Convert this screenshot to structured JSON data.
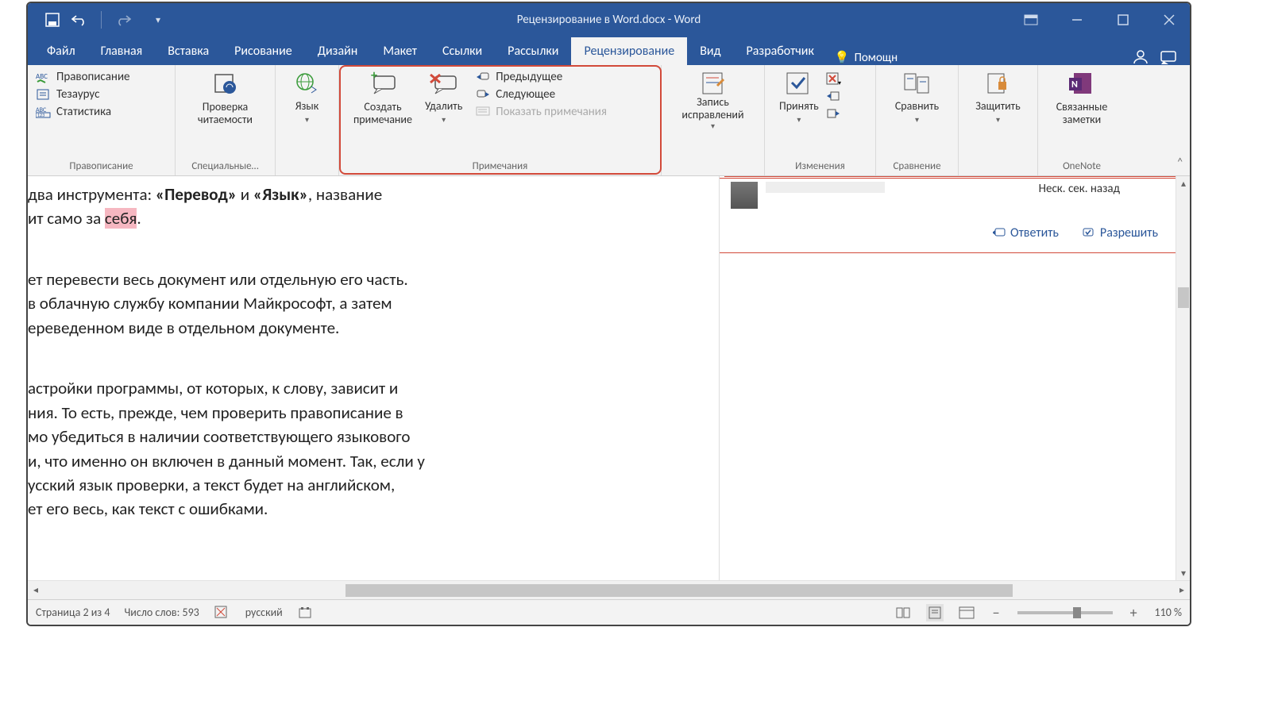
{
  "title": "Рецензирование в Word.docx  -  Word",
  "tabs": [
    "Файл",
    "Главная",
    "Вставка",
    "Рисование",
    "Дизайн",
    "Макет",
    "Ссылки",
    "Рассылки",
    "Рецензирование",
    "Вид",
    "Разработчик"
  ],
  "active_tab_index": 8,
  "tell_me": "Помощн",
  "ribbon": {
    "g1": {
      "label": "Правописание",
      "items": [
        "Правописание",
        "Тезаурус",
        "Статистика"
      ]
    },
    "g2": {
      "label": "Специальные…",
      "btn": "Проверка\nчитаемости"
    },
    "g3": {
      "btn": "Язык"
    },
    "g4": {
      "label": "Примечания",
      "new": "Создать\nпримечание",
      "del": "Удалить",
      "prev": "Предыдущее",
      "next": "Следующее",
      "show": "Показать примечания"
    },
    "g5": {
      "btn": "Запись\nисправлений"
    },
    "g6": {
      "label": "Изменения",
      "btn": "Принять"
    },
    "g7": {
      "label": "Сравнение",
      "btn": "Сравнить"
    },
    "g8": {
      "btn": "Защитить"
    },
    "g9": {
      "label": "OneNote",
      "btn": "Связанные\nзаметки"
    }
  },
  "document": {
    "l1a": "два инструмента: ",
    "l1b": "«Перевод»",
    "l1c": " и ",
    "l1d": "«Язык»",
    "l1e": ", название",
    "l2a": "ит само за ",
    "l2hl": "себя",
    "l2b": ".",
    "p2l1": "ет перевести весь документ или отдельную его часть.",
    "p2l2": "в облачную службу компании Майкрософт, а затем",
    "p2l3": "ереведенном виде в отдельном документе.",
    "p3l1": "астройки программы, от которых, к слову, зависит и",
    "p3l2": "ния. То есть, прежде, чем проверить правописание в",
    "p3l3": "мо убедиться в наличии соответствующего языкового",
    "p3l4": "и, что именно он включен в данный момент. Так, если у",
    "p3l5": "усский язык проверки, а текст будет на английском,",
    "p3l6": "ет его весь, как текст с ошибками."
  },
  "comment": {
    "time": "Неск. сек. назад",
    "reply": "Ответить",
    "resolve": "Разрешить"
  },
  "status": {
    "page": "Страница 2 из 4",
    "words": "Число слов: 593",
    "lang": "русский",
    "zoom": "110 %"
  }
}
